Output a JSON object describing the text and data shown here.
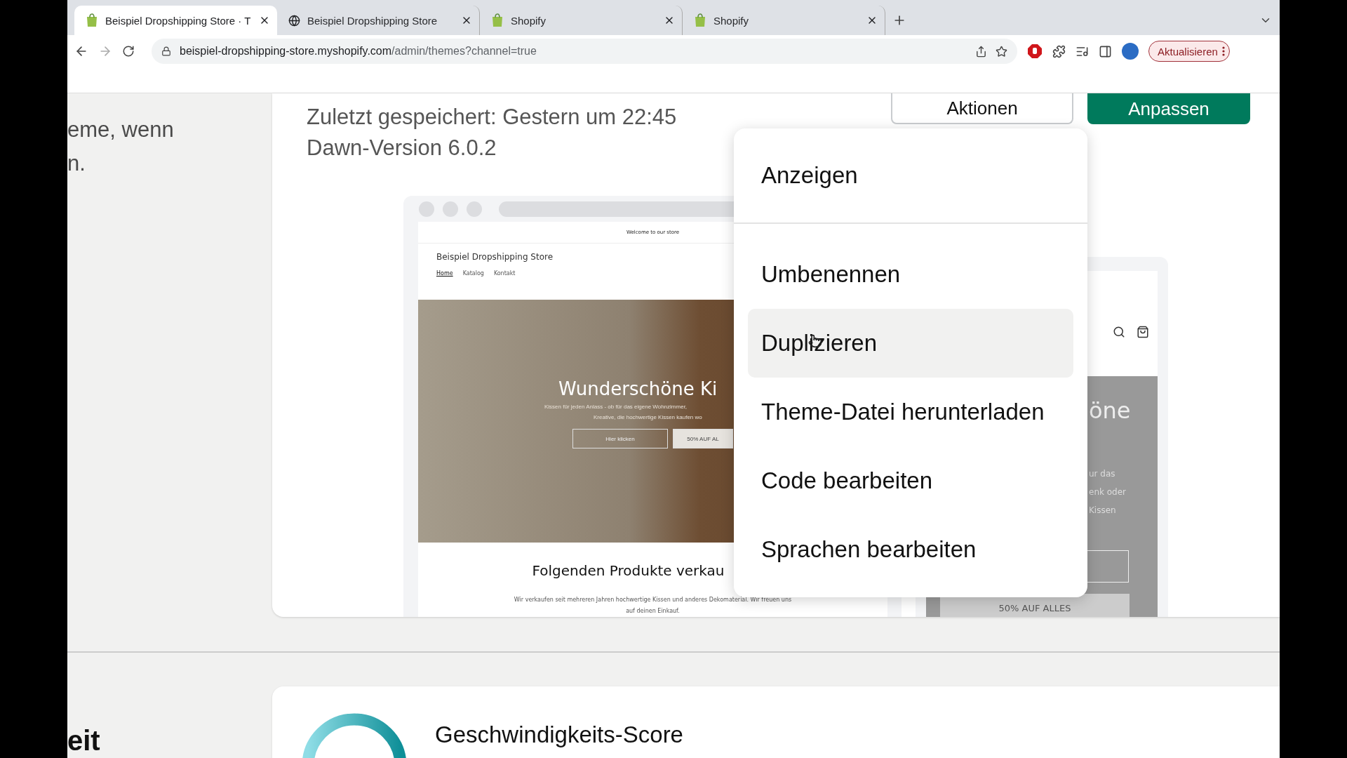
{
  "browser": {
    "tabs": [
      {
        "title": "Beispiel Dropshipping Store · T",
        "selected": true
      },
      {
        "title": "Beispiel Dropshipping Store",
        "selected": false
      },
      {
        "title": "Shopify",
        "selected": false
      },
      {
        "title": "Shopify",
        "selected": false
      }
    ],
    "url": {
      "host": "beispiel-dropshipping-store.myshopify.com",
      "path": "/admin/themes?channel=true"
    },
    "update_button": "Aktualisieren"
  },
  "sidebar_text": {
    "lines": [
      "eme, wenn",
      "n."
    ]
  },
  "theme_card": {
    "saved": "Zuletzt gespeichert: Gestern um 22:45",
    "version": "Dawn-Version 6.0.2",
    "buttons": [
      {
        "label": "Aktionen",
        "kind": "secondary"
      },
      {
        "label": "Anpassen",
        "kind": "primary"
      }
    ]
  },
  "desktop_preview": {
    "announcement": "Welcome to our store",
    "store_name": "Beispiel Dropshipping Store",
    "nav": [
      {
        "label": "Home",
        "selected": true
      },
      {
        "label": "Katalog",
        "selected": false
      },
      {
        "label": "Kontakt",
        "selected": false
      }
    ],
    "hero": {
      "heading": "Wunderschöne Ki",
      "text_lines": [
        "Kissen für jeden Anlass - ob für das eigene Wohnzimmer,",
        "Kreative, die hochwertige Kissen kaufen wo"
      ],
      "buttons": [
        {
          "label": "Hier klicken",
          "kind": "outline"
        },
        {
          "label": "50% AUF AL",
          "kind": "solid"
        }
      ]
    },
    "section_heading": "Folgenden Produkte verkau",
    "section_text": "Wir verkaufen seit mehreren Jahren hochwertige Kissen und anderes Dekomaterial. Wir freuen uns auf deinen Einkauf."
  },
  "mobile_preview": {
    "heading": "öne",
    "text_lines": [
      "ur das",
      "enk oder",
      "Kissen"
    ],
    "button": "50% AUF ALLES"
  },
  "actions_menu": {
    "groups": [
      {
        "items": [
          {
            "label": "Anzeigen",
            "highlighted": false
          }
        ]
      },
      {
        "items": [
          {
            "label": "Umbenennen",
            "highlighted": false
          },
          {
            "label": "Duplizieren",
            "highlighted": true
          },
          {
            "label": "Theme-Datei herunterladen",
            "highlighted": false
          },
          {
            "label": "Code bearbeiten",
            "highlighted": false
          },
          {
            "label": "Sprachen bearbeiten",
            "highlighted": false
          }
        ]
      }
    ]
  },
  "speed_section": {
    "heading": "eit",
    "score_title": "Geschwindigkeits-Score"
  }
}
